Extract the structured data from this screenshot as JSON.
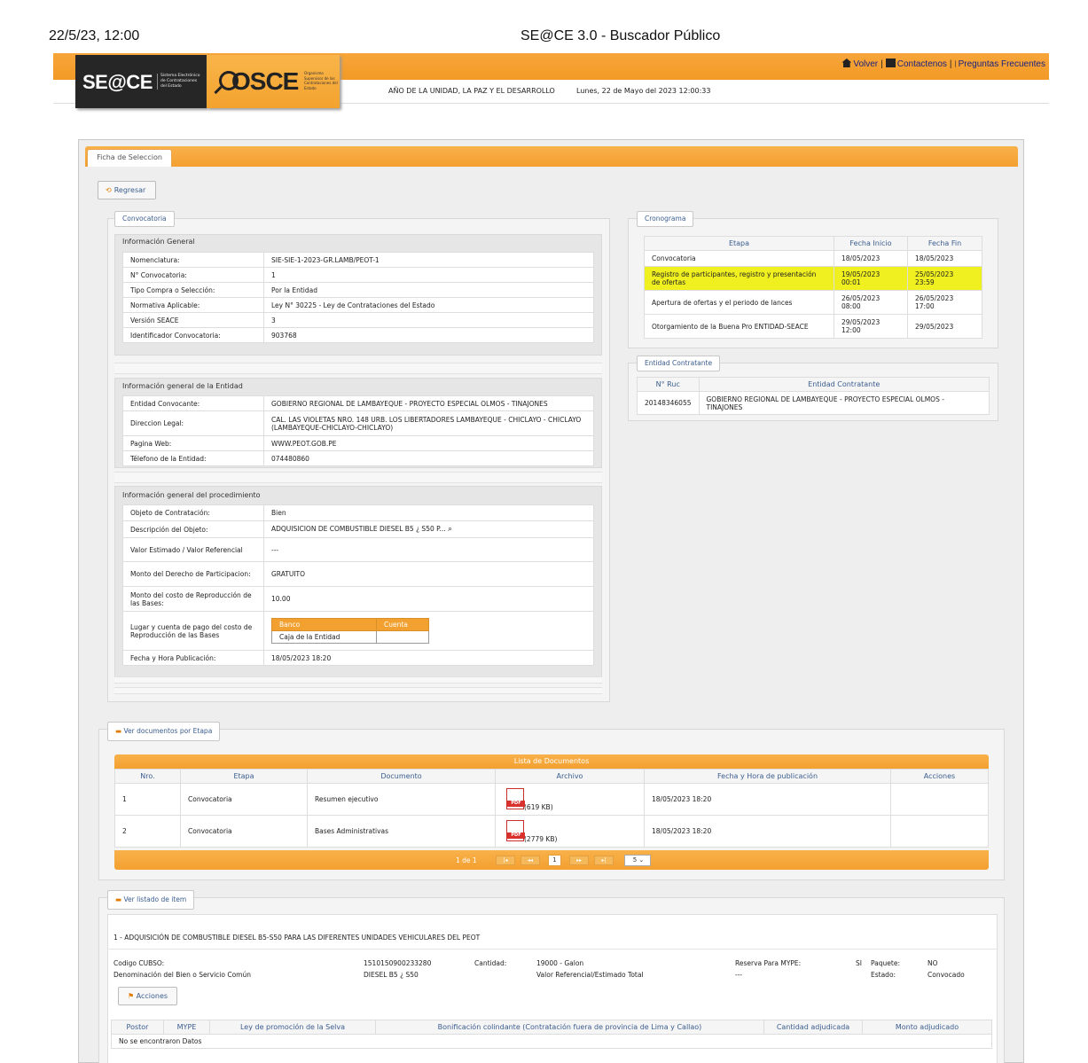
{
  "print": {
    "date": "22/5/23, 12:00",
    "title": "SE@CE 3.0 - Buscador Público"
  },
  "header": {
    "seace_logo": "SE@CE",
    "seace_sub": "Sistema Electrónico de Contrataciones del Estado",
    "osce_logo": "OSCE",
    "osce_sub": "Organismo Supervisor de las Contrataciones del Estado",
    "links": {
      "volver": "Volver",
      "contactenos": "Contactenos",
      "preguntas": "Preguntas Frecuentes"
    },
    "motto": "AÑO DE LA UNIDAD, LA PAZ Y EL DESARROLLO",
    "datetime": "Lunes, 22 de Mayo del 2023  12:00:33"
  },
  "tab": "Ficha de Seleccion",
  "regresar": "Regresar",
  "convocatoria": {
    "legend": "Convocatoria",
    "general_title": "Información General",
    "general": [
      {
        "k": "Nomenclatura:",
        "v": "SIE-SIE-1-2023-GR.LAMB/PEOT-1"
      },
      {
        "k": "N° Convocatoria:",
        "v": "1"
      },
      {
        "k": "Tipo Compra o Selección:",
        "v": "Por la Entidad"
      },
      {
        "k": "Normativa Aplicable:",
        "v": "Ley N° 30225 - Ley de Contrataciones del Estado"
      },
      {
        "k": "Versión SEACE",
        "v": "3"
      },
      {
        "k": "Identificador Convocatoria:",
        "v": "903768"
      }
    ],
    "entidad_title": "Información general de la Entidad",
    "entidad": [
      {
        "k": "Entidad Convocante:",
        "v": "GOBIERNO REGIONAL DE LAMBAYEQUE - PROYECTO ESPECIAL OLMOS - TINAJONES"
      },
      {
        "k": "Direccion Legal:",
        "v": "CAL. LAS VIOLETAS NRO. 148 URB. LOS LIBERTADORES LAMBAYEQUE - CHICLAYO - CHICLAYO (LAMBAYEQUE-CHICLAYO-CHICLAYO)"
      },
      {
        "k": "Pagina Web:",
        "v": "WWW.PEOT.GOB.PE"
      },
      {
        "k": "Télefono de la Entidad:",
        "v": "074480860"
      }
    ],
    "proc_title": "Información general del procedimiento",
    "proc": [
      {
        "k": "Objeto de Contratación:",
        "v": "Bien"
      },
      {
        "k": "Descripción del Objeto:",
        "v": "ADQUISICION DE COMBUSTIBLE DIESEL B5 ¿ S50 P..."
      },
      {
        "k": "Valor Estimado / Valor Referencial",
        "v": "---"
      },
      {
        "k": "Monto del Derecho de Participacion:",
        "v": "GRATUITO"
      },
      {
        "k": "Monto del costo de Reproducción de las Bases:",
        "v": "10.00"
      }
    ],
    "pago_label": "Lugar y cuenta de pago del costo de Reproducción de las Bases",
    "pago_headers": [
      "Banco",
      "Cuenta"
    ],
    "pago_row": [
      "Caja de la Entidad",
      ""
    ],
    "fecha_pub_label": "Fecha y Hora Publicación:",
    "fecha_pub": "18/05/2023 18:20"
  },
  "cronograma": {
    "legend": "Cronograma",
    "headers": [
      "Etapa",
      "Fecha Inicio",
      "Fecha Fin"
    ],
    "rows": [
      {
        "etapa": "Convocatoria",
        "inicio": "18/05/2023",
        "fin": "18/05/2023"
      },
      {
        "etapa": "Registro de participantes, registro y presentación de ofertas",
        "inicio": "19/05/2023 00:01",
        "fin": "25/05/2023 23:59"
      },
      {
        "etapa": "Apertura de ofertas y el periodo de lances",
        "inicio": "26/05/2023 08:00",
        "fin": "26/05/2023 17:00"
      },
      {
        "etapa": "Otorgamiento de la Buena Pro ENTIDAD-SEACE",
        "inicio": "29/05/2023 12:00",
        "fin": "29/05/2023"
      }
    ]
  },
  "entidad_contratante": {
    "legend": "Entidad Contratante",
    "headers": [
      "N° Ruc",
      "Entidad Contratante"
    ],
    "ruc": "20148346055",
    "nombre": "GOBIERNO REGIONAL DE LAMBAYEQUE - PROYECTO ESPECIAL OLMOS - TINAJONES"
  },
  "documentos": {
    "legend": "Ver documentos por Etapa",
    "title": "Lista de Documentos",
    "headers": [
      "Nro.",
      "Etapa",
      "Documento",
      "Archivo",
      "Fecha y Hora de publicación",
      "Acciones"
    ],
    "rows": [
      {
        "nro": "1",
        "etapa": "Convocatoria",
        "doc": "Resumen ejecutivo",
        "size": "(619 KB)",
        "fecha": "18/05/2023 18:20"
      },
      {
        "nro": "2",
        "etapa": "Convocatoria",
        "doc": "Bases Administrativas",
        "size": "(2779 KB)",
        "fecha": "18/05/2023 18:20"
      }
    ],
    "pager": {
      "label": "1 de 1",
      "current": "1",
      "per_page": "5"
    }
  },
  "items": {
    "legend": "Ver listado de item",
    "item_title": "1 - ADQUISICIÓN DE COMBUSTIBLE DIESEL B5-S50 PARA LAS DIFERENTES UNIDADES VEHICULARES DEL PEOT",
    "codigo_label": "Codigo CUBSO:",
    "codigo": "1510150900233280",
    "cantidad_label": "Cantidad:",
    "cantidad": "19000 - Galon",
    "reserva_label": "Reserva Para MYPE:",
    "reserva": "SI",
    "paquete_label": "Paquete:",
    "paquete": "NO",
    "denom_label": "Denominación del Bien o Servicio Común",
    "denom": "DIESEL B5 ¿ S50",
    "valor_label": "Valor Referencial/Estimado Total",
    "valor": "---",
    "estado_label": "Estado:",
    "estado": "Convocado",
    "acciones": "Acciones",
    "headers": [
      "Postor",
      "MYPE",
      "Ley de promoción de la Selva",
      "Bonificación colindante (Contratación fuera de provincia de Lima y Callao)",
      "Cantidad adjudicada",
      "Monto adjudicado"
    ],
    "empty": "No se encontraron Datos"
  }
}
